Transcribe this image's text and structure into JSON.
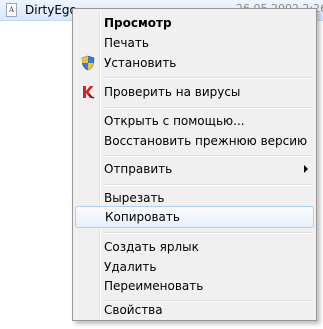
{
  "file": {
    "icon_letter": "A",
    "name": "DirtyEgo",
    "date": "26.05.2002 2:26"
  },
  "menu": {
    "items": [
      {
        "label": "Просмотр",
        "bold": true
      },
      {
        "label": "Печать"
      },
      {
        "label": "Установить",
        "icon": "uac-shield-icon"
      },
      {
        "label": "Проверить на вирусы",
        "icon": "kaspersky-icon"
      },
      {
        "label": "Открыть с помощью..."
      },
      {
        "label": "Восстановить прежнюю версию"
      },
      {
        "label": "Отправить",
        "submenu": true
      },
      {
        "label": "Вырезать"
      },
      {
        "label": "Копировать",
        "highlighted": true
      },
      {
        "label": "Создать ярлык"
      },
      {
        "label": "Удалить"
      },
      {
        "label": "Переименовать"
      },
      {
        "label": "Свойства"
      }
    ]
  },
  "colors": {
    "highlight_border": "#aecff7",
    "menu_background": "#f0f0f0",
    "kaspersky_red": "#d6202a"
  }
}
